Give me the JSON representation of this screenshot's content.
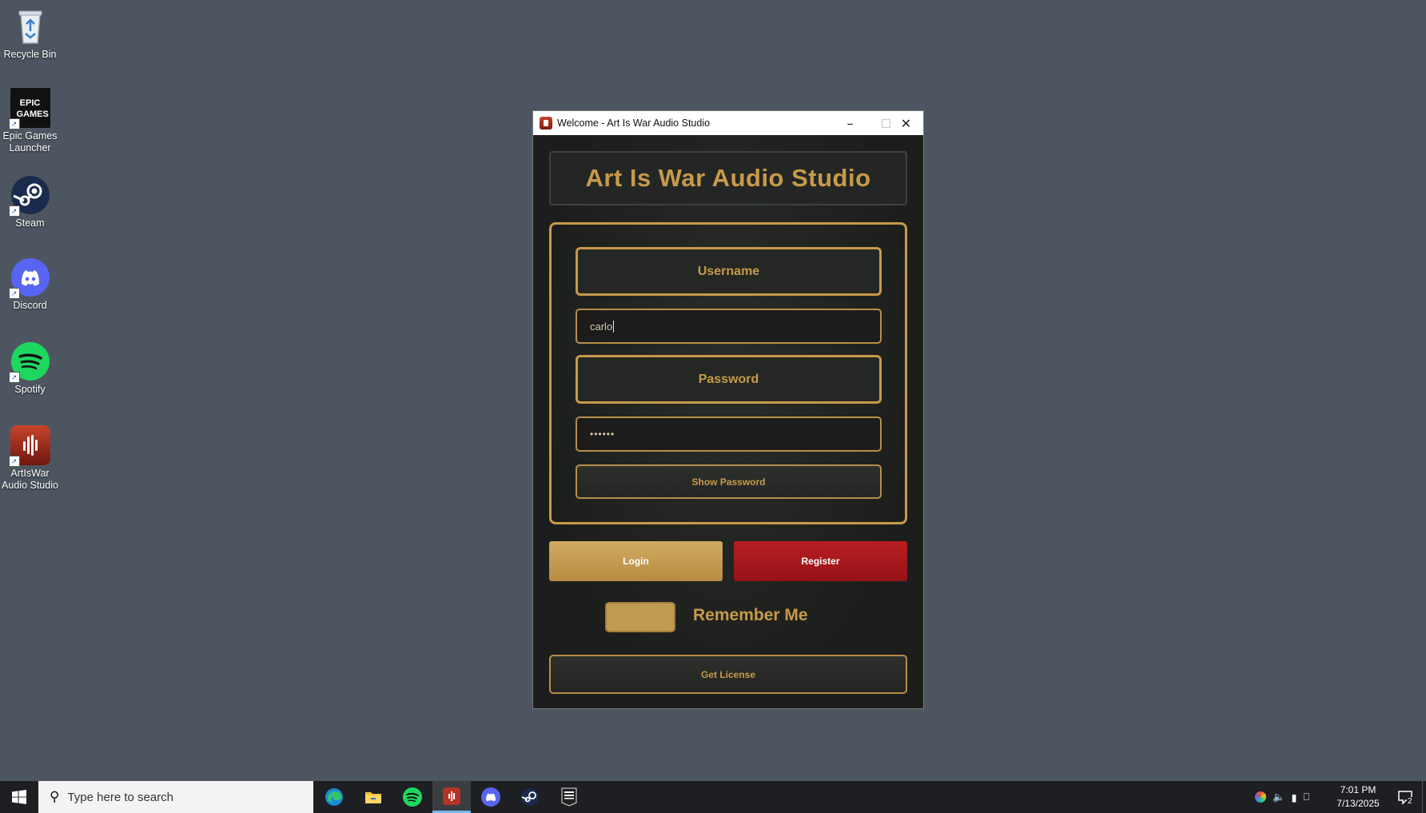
{
  "desktop": {
    "icons": [
      {
        "label": "Recycle Bin"
      },
      {
        "label": "Epic Games Launcher"
      },
      {
        "label": "Steam"
      },
      {
        "label": "Discord"
      },
      {
        "label": "Spotify"
      },
      {
        "label": "ArtIsWar Audio Studio"
      }
    ],
    "epic_logo_text": "EPIC GAMES"
  },
  "window": {
    "title": "Welcome - Art Is War Audio Studio",
    "header": "Art Is War Audio Studio",
    "username_label": "Username",
    "username_value": "carlo",
    "password_label": "Password",
    "password_value": "••••••",
    "show_password_label": "Show Password",
    "login_label": "Login",
    "register_label": "Register",
    "remember_me_label": "Remember Me",
    "remember_me_checked": false,
    "get_license_label": "Get License",
    "colors": {
      "gold": "#c79a4a",
      "register_red": "#b81d22",
      "background": "#1e2120"
    }
  },
  "taskbar": {
    "search_placeholder": "Type here to search",
    "apps": [
      "edge-icon",
      "file-explorer-icon",
      "spotify-icon",
      "artiswar-icon",
      "discord-icon",
      "steam-icon",
      "epic-games-icon"
    ],
    "active_app": "artiswar-icon",
    "time": "7:01 PM",
    "date": "7/13/2025",
    "notification_count": "2"
  }
}
